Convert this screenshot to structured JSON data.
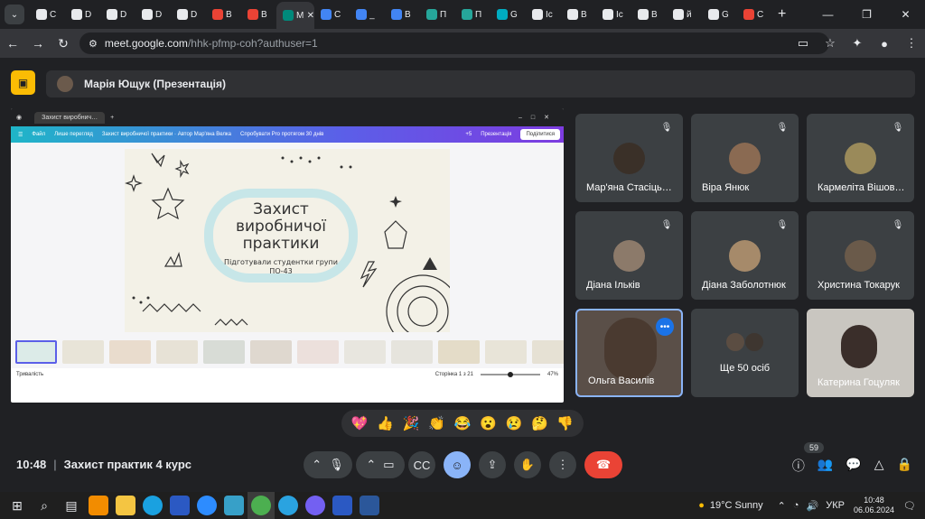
{
  "browser": {
    "tabs": [
      {
        "title": "C",
        "color": "#e8eaed"
      },
      {
        "title": "D",
        "color": "#e8eaed"
      },
      {
        "title": "D",
        "color": "#e8eaed"
      },
      {
        "title": "D",
        "color": "#e8eaed"
      },
      {
        "title": "D",
        "color": "#e8eaed"
      },
      {
        "title": "B",
        "color": "#ea4335"
      },
      {
        "title": "B",
        "color": "#ea4335"
      },
      {
        "title": "M",
        "color": "#00897b",
        "active": true
      },
      {
        "title": "C",
        "color": "#4285f4"
      },
      {
        "title": "_",
        "color": "#4285f4"
      },
      {
        "title": "B",
        "color": "#4285f4"
      },
      {
        "title": "П",
        "color": "#26a69a"
      },
      {
        "title": "П",
        "color": "#26a69a"
      },
      {
        "title": "G",
        "color": "#00acc1"
      },
      {
        "title": "Ic",
        "color": "#e8eaed"
      },
      {
        "title": "B",
        "color": "#e8eaed"
      },
      {
        "title": "Ic",
        "color": "#e8eaed"
      },
      {
        "title": "B",
        "color": "#e8eaed"
      },
      {
        "title": "й",
        "color": "#e8eaed"
      },
      {
        "title": "G",
        "color": "#e8eaed"
      },
      {
        "title": "C",
        "color": "#ea4335"
      }
    ],
    "url_host": "meet.google.com",
    "url_path": "/hhk-pfmp-coh?authuser=1"
  },
  "meet": {
    "presenter": "Марія Ющук (Презентація)",
    "meeting_time": "10:48",
    "meeting_title": "Захист практик 4 курс",
    "participant_count": "59",
    "participants": [
      {
        "name": "Мар'яна Стасіць…"
      },
      {
        "name": "Віра Янюк"
      },
      {
        "name": "Кармеліта Вішов…"
      },
      {
        "name": "Діана Ількiв"
      },
      {
        "name": "Діана Заболотнюк"
      },
      {
        "name": "Христина Токарук"
      },
      {
        "name": "Ольга Василів"
      },
      {
        "name": "Ще 50 осіб"
      },
      {
        "name": "Катерина Гоцуляк"
      }
    ],
    "reactions": [
      "💖",
      "👍",
      "🎉",
      "👏",
      "😂",
      "😮",
      "😢",
      "🤔",
      "👎"
    ]
  },
  "shared_screen": {
    "tab_title": "Захист виробнич…",
    "canva": {
      "menu_file": "Файл",
      "menu_view": "Лише перегляд",
      "doc_title": "Захист виробничої практики · Автор Мар'яна Велка",
      "promo": "Спробувати Pro протягом 30 днів",
      "avatars_more": "+5",
      "present": "Презентація",
      "share": "Поділитися"
    },
    "slide_title": "Захист виробничої практики",
    "slide_subtitle": "Підготували студентки групи ПО-43",
    "footer_duration": "Тривалість",
    "footer_page": "Сторінка 1 з 21",
    "footer_zoom": "47%"
  },
  "taskbar": {
    "weather": "19°C  Sunny",
    "lang": "УКР",
    "time": "10:48",
    "date": "06.06.2024"
  }
}
